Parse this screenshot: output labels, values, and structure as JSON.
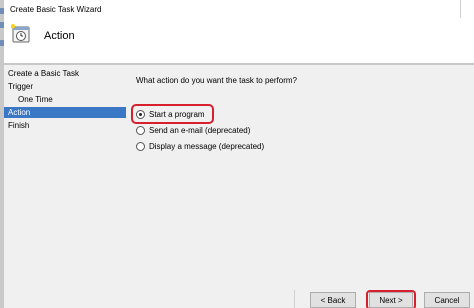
{
  "window": {
    "title": "Create Basic Task Wizard"
  },
  "header": {
    "title": "Action",
    "icon": "task-clock-icon"
  },
  "nav": {
    "items": [
      {
        "label": "Create a Basic Task",
        "sub": false,
        "active": false
      },
      {
        "label": "Trigger",
        "sub": false,
        "active": false
      },
      {
        "label": "One Time",
        "sub": true,
        "active": false
      },
      {
        "label": "Action",
        "sub": false,
        "active": true
      },
      {
        "label": "Finish",
        "sub": false,
        "active": false
      }
    ]
  },
  "main": {
    "question": "What action do you want the task to perform?",
    "options": [
      {
        "label": "Start a program",
        "checked": true
      },
      {
        "label": "Send an e-mail (deprecated)",
        "checked": false
      },
      {
        "label": "Display a message (deprecated)",
        "checked": false
      }
    ]
  },
  "buttons": {
    "back": "< Back",
    "next": "Next >",
    "cancel": "Cancel"
  },
  "colors": {
    "selection": "#3a77c4",
    "highlight_box": "#d62030"
  }
}
